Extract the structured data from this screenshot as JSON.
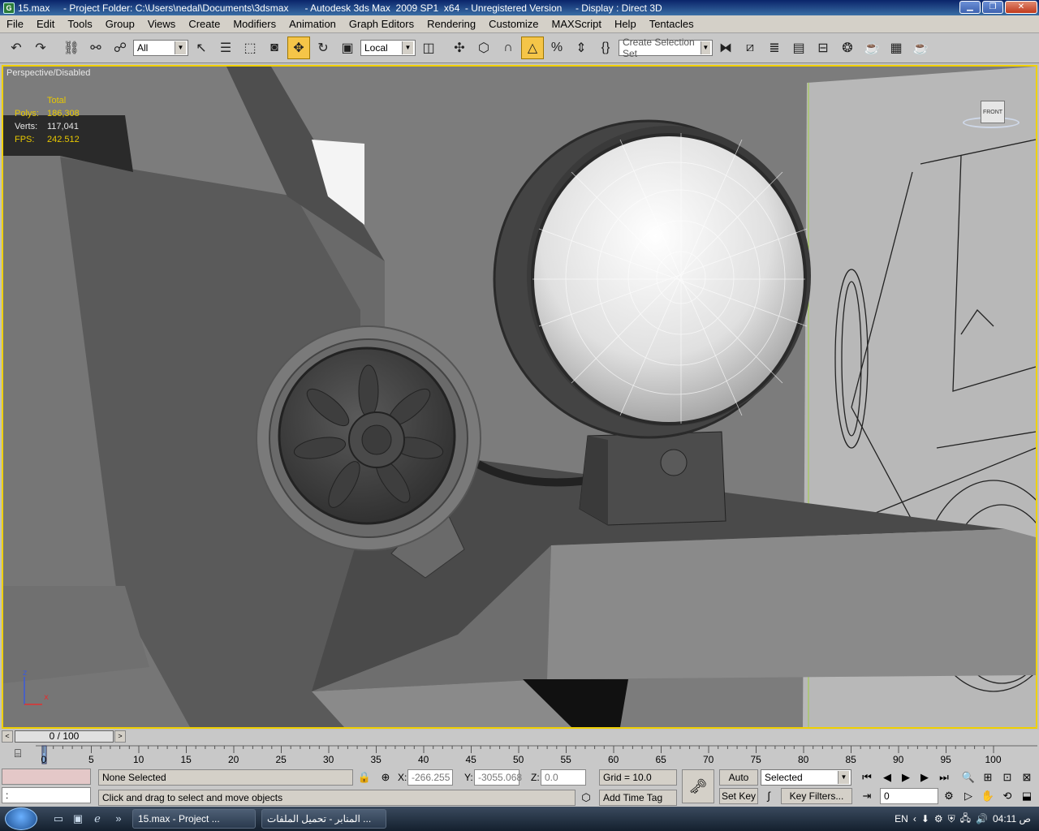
{
  "window": {
    "title": "15.max     - Project Folder: C:\\Users\\nedal\\Documents\\3dsmax      - Autodesk 3ds Max  2009 SP1  x64  - Unregistered Version     - Display : Direct 3D",
    "minimize_icon": "minimize-icon",
    "maximize_icon": "restore-icon",
    "close_icon": "close-icon"
  },
  "menu": [
    "File",
    "Edit",
    "Tools",
    "Group",
    "Views",
    "Create",
    "Modifiers",
    "Animation",
    "Graph Editors",
    "Rendering",
    "Customize",
    "MAXScript",
    "Help",
    "Tentacles"
  ],
  "toolbar": {
    "selection_filter": "All",
    "ref_coord": "Local",
    "named_selection_placeholder": "Create Selection Set"
  },
  "viewport": {
    "label": "Perspective/Disabled",
    "stats": {
      "header": "Total",
      "polys_label": "Polys:",
      "polys_value": "186,308",
      "verts_label": "Verts:",
      "verts_value": "117,041",
      "fps_label": "FPS:",
      "fps_value": "242.512"
    },
    "viewcube_label": "FRONT",
    "axis_z": "z",
    "axis_x": "x"
  },
  "timeline": {
    "slider_value": "0 / 100",
    "ticks": [
      "0",
      "5",
      "10",
      "15",
      "20",
      "25",
      "30",
      "35",
      "40",
      "45",
      "50",
      "55",
      "60",
      "65",
      "70",
      "75",
      "80",
      "85",
      "90",
      "95",
      "100"
    ]
  },
  "status": {
    "maxscript_prompt": ":",
    "selection": "None Selected",
    "prompt": "Click and drag to select and move objects",
    "x_label": "X:",
    "x_value": "-266.255",
    "y_label": "Y:",
    "y_value": "-3055.068",
    "z_label": "Z:",
    "z_value": "0.0",
    "grid": "Grid = 10.0",
    "add_time_tag": "Add Time Tag",
    "auto_key": "Auto Key",
    "set_key": "Set Key",
    "key_mode": "Selected",
    "key_filters": "Key Filters...",
    "frame": "0"
  },
  "taskbar": {
    "task1": "15.max      - Project ...",
    "task2": "المنابر - تحميل الملفات ...",
    "lang": "EN",
    "clock": "04:11 ص"
  }
}
